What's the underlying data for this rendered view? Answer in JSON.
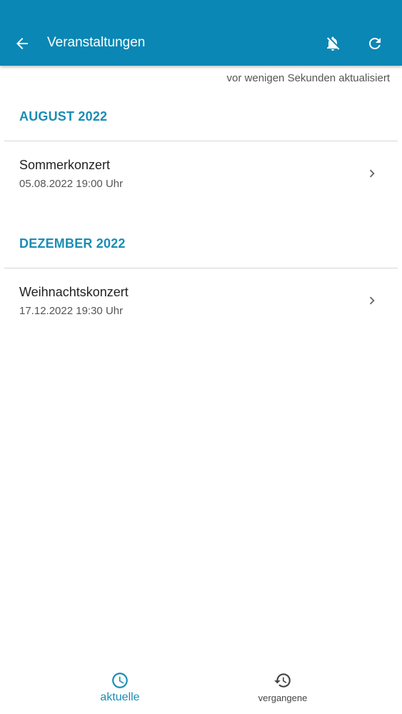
{
  "app_bar": {
    "title": "Veranstaltungen",
    "back_icon": "arrow-left-icon",
    "notifications_icon": "bell-off-icon",
    "refresh_icon": "refresh-icon",
    "background_color": "#0a87b4"
  },
  "last_updated": "vor wenigen Sekunden aktualisiert",
  "sections": [
    {
      "header": "AUGUST 2022",
      "events": [
        {
          "title": "Sommerkonzert",
          "datetime": "05.08.2022 19:00 Uhr"
        }
      ]
    },
    {
      "header": "DEZEMBER 2022",
      "events": [
        {
          "title": "Weihnachtskonzert",
          "datetime": "17.12.2022 19:30 Uhr"
        }
      ]
    }
  ],
  "bottom_nav": {
    "items": [
      {
        "label": "aktuelle",
        "icon": "clock-icon",
        "active": true
      },
      {
        "label": "vergangene",
        "icon": "history-icon",
        "active": false
      }
    ]
  },
  "colors": {
    "accent": "#1a8db5",
    "divider": "#d6d6d6"
  }
}
